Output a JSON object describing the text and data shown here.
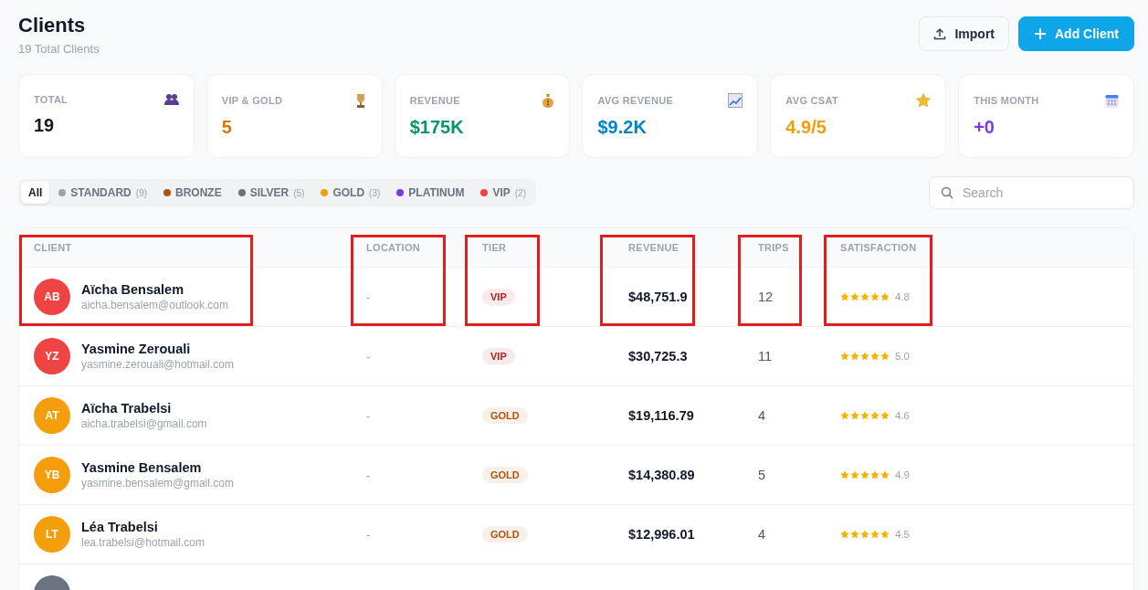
{
  "header": {
    "title": "Clients",
    "subtitle": "19 Total Clients",
    "buttons": [
      {
        "label": "Import",
        "kind": "import"
      },
      {
        "label": "Add Client",
        "kind": "add"
      }
    ]
  },
  "stats": [
    {
      "label": "TOTAL",
      "value": "19",
      "kind": "people",
      "color": "#111827"
    },
    {
      "label": "VIP & GOLD",
      "value": "5",
      "kind": "trophy",
      "color": "#d97706"
    },
    {
      "label": "REVENUE",
      "value": "$175K",
      "kind": "moneybag",
      "color": "#059669"
    },
    {
      "label": "AVG REVENUE",
      "value": "$9.2K",
      "kind": "chart",
      "color": "#0284c7"
    },
    {
      "label": "AVG CSAT",
      "value": "4.9/5",
      "kind": "star",
      "color": "#f59e0b"
    },
    {
      "label": "THIS MONTH",
      "value": "+0",
      "kind": "calendar",
      "color": "#7c3aed"
    }
  ],
  "filters": [
    {
      "label": "All",
      "selected": true
    },
    {
      "label": "STANDARD",
      "count": "(9)",
      "color": "#9ca3af",
      "selected": false
    },
    {
      "label": "BRONZE",
      "color": "#b45309",
      "selected": false
    },
    {
      "label": "SILVER",
      "count": "(5)",
      "color": "#6b7280",
      "selected": false
    },
    {
      "label": "GOLD",
      "count": "(3)",
      "color": "#f59e0b",
      "selected": false
    },
    {
      "label": "PLATINUM",
      "color": "#7c3aed",
      "selected": false
    },
    {
      "label": "VIP",
      "count": "(2)",
      "color": "#ef4444",
      "selected": false
    }
  ],
  "search": {
    "placeholder": "Search"
  },
  "table": {
    "columns": [
      {
        "label": "CLIENT",
        "highlighted": true
      },
      {
        "label": "LOCATION",
        "highlighted": true
      },
      {
        "label": "TIER",
        "highlighted": true
      },
      {
        "label": "REVENUE",
        "highlighted": true
      },
      {
        "label": "TRIPS",
        "highlighted": true
      },
      {
        "label": "SATISFACTION",
        "highlighted": true
      }
    ],
    "rows": [
      {
        "avatar": {
          "initials": "AB",
          "color": "#ef4444"
        },
        "name": "Aïcha Bensalem",
        "email": "aicha.bensalem@outlook.com",
        "location": "-",
        "tier": {
          "label": "VIP",
          "color": "#b91c1c"
        },
        "revenue": "$48,751.9",
        "trips": "12",
        "stars": 5,
        "rating": "4.8"
      },
      {
        "avatar": {
          "initials": "YZ",
          "color": "#ef4444"
        },
        "name": "Yasmine Zerouali",
        "email": "yasmine.zerouali@hotmail.com",
        "location": "-",
        "tier": {
          "label": "VIP",
          "color": "#b91c1c"
        },
        "revenue": "$30,725.3",
        "trips": "11",
        "stars": 5,
        "rating": "5.0"
      },
      {
        "avatar": {
          "initials": "AT",
          "color": "#f59e0b"
        },
        "name": "Aïcha Trabelsi",
        "email": "aicha.trabelsi@gmail.com",
        "location": "-",
        "tier": {
          "label": "GOLD",
          "color": "#b45309"
        },
        "revenue": "$19,116.79",
        "trips": "4",
        "stars": 5,
        "rating": "4.6"
      },
      {
        "avatar": {
          "initials": "YB",
          "color": "#f59e0b"
        },
        "name": "Yasmine Bensalem",
        "email": "yasmine.bensalem@gmail.com",
        "location": "-",
        "tier": {
          "label": "GOLD",
          "color": "#b45309"
        },
        "revenue": "$14,380.89",
        "trips": "5",
        "stars": 5,
        "rating": "4.9"
      },
      {
        "avatar": {
          "initials": "LT",
          "color": "#f59e0b"
        },
        "name": "Léa Trabelsi",
        "email": "lea.trabelsi@hotmail.com",
        "location": "-",
        "tier": {
          "label": "GOLD",
          "color": "#b45309"
        },
        "revenue": "$12,996.01",
        "trips": "4",
        "stars": 5,
        "rating": "4.5"
      },
      {
        "avatar": {
          "color": "#6b7280"
        }
      }
    ]
  }
}
